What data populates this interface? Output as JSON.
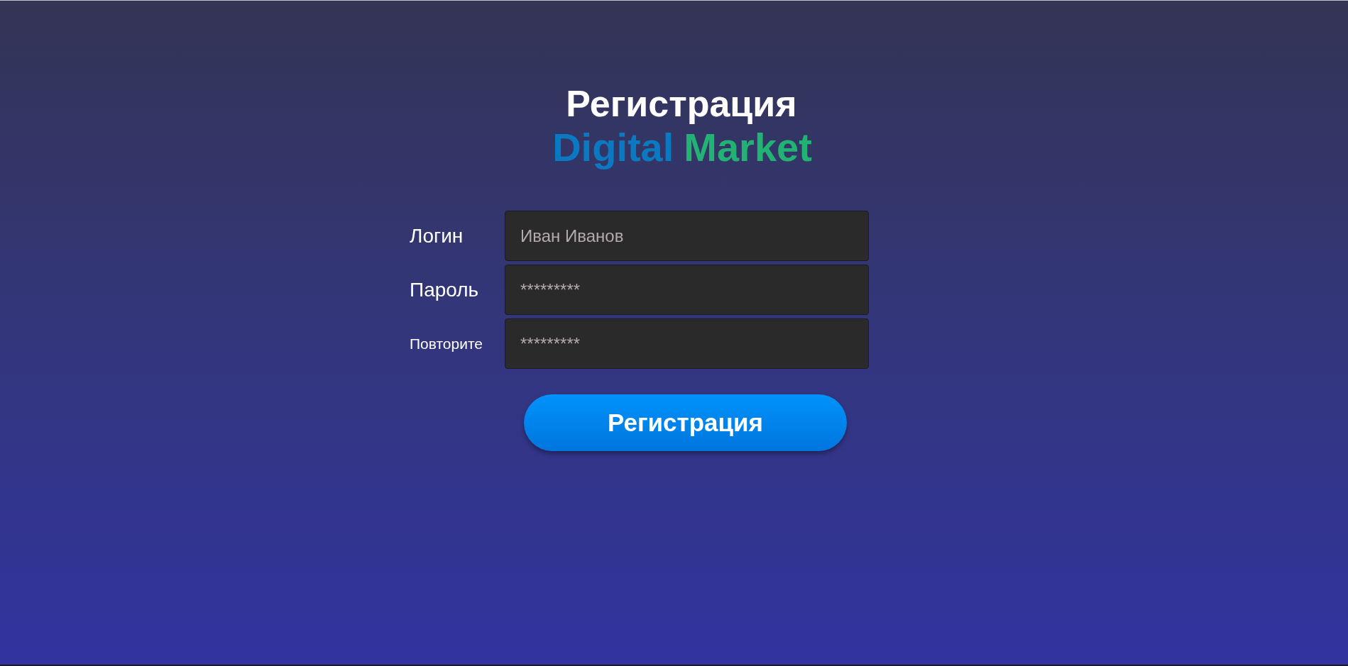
{
  "title": "Регистрация",
  "logo": [
    "Digital",
    "Market"
  ],
  "fields": [
    {
      "label": "Логин",
      "placeholder": "Иван Иванов"
    },
    {
      "label": "Пароль",
      "placeholder": "*********"
    },
    {
      "label": "Повторите",
      "placeholder": "*********"
    }
  ],
  "submit_button": "Регистрация"
}
